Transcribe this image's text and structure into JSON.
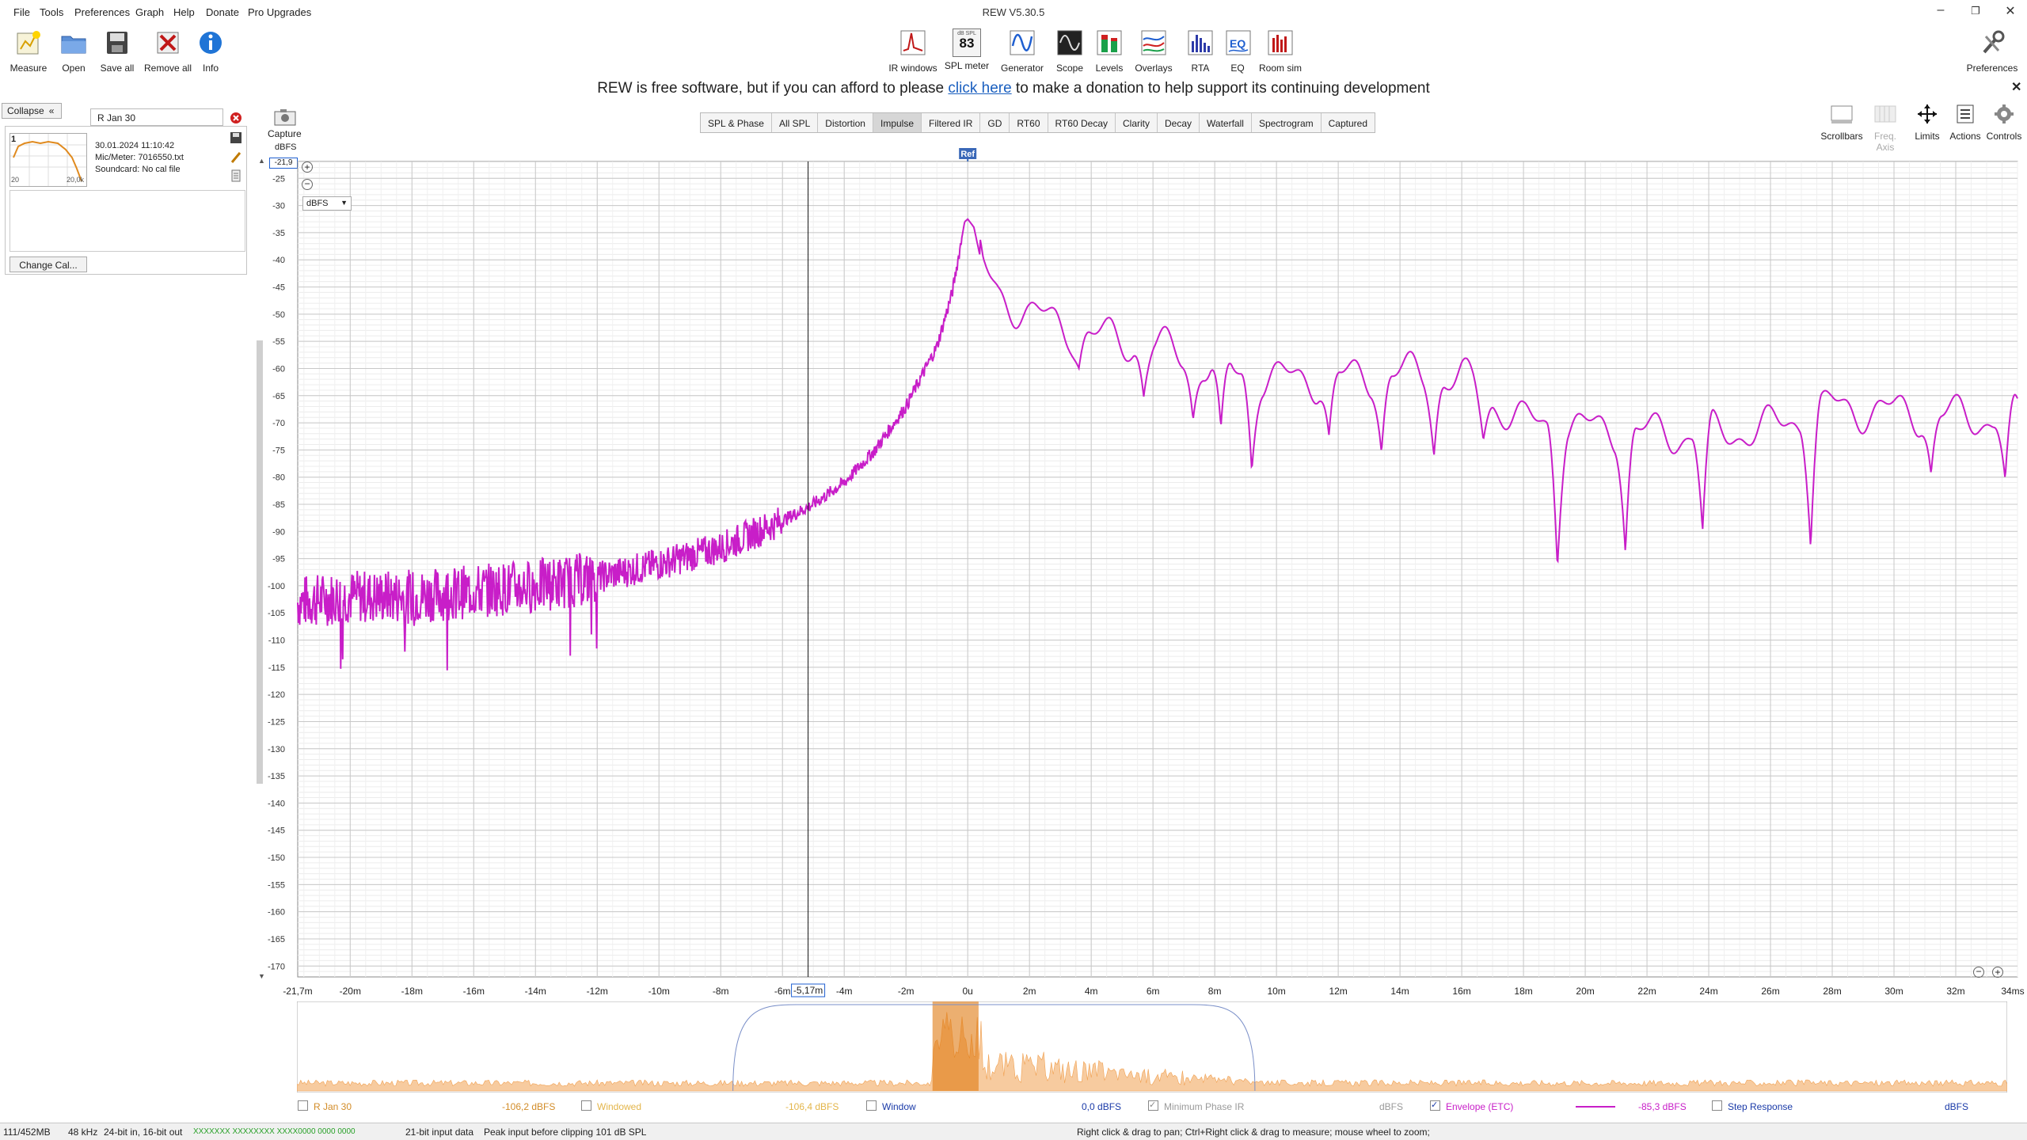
{
  "window": {
    "title": "REW V5.30.5"
  },
  "menu": [
    "File",
    "Tools",
    "Preferences",
    "Graph",
    "Help",
    "Donate",
    "Pro Upgrades"
  ],
  "toolbar_left": [
    {
      "label": "Measure",
      "icon": "measure-icon"
    },
    {
      "label": "Open",
      "icon": "open-folder-icon"
    },
    {
      "label": "Save all",
      "icon": "save-icon"
    },
    {
      "label": "Remove all",
      "icon": "remove-icon"
    },
    {
      "label": "Info",
      "icon": "info-icon"
    }
  ],
  "toolbar_center": [
    {
      "label": "IR windows",
      "icon": "ir-windows-icon"
    },
    {
      "label": "SPL meter",
      "icon": "spl-meter-icon",
      "badge_top": "dB SPL",
      "badge_value": "83"
    },
    {
      "label": "Generator",
      "icon": "generator-icon"
    },
    {
      "label": "Scope",
      "icon": "scope-icon"
    },
    {
      "label": "Levels",
      "icon": "levels-icon"
    },
    {
      "label": "Overlays",
      "icon": "overlays-icon"
    },
    {
      "label": "RTA",
      "icon": "rta-icon"
    },
    {
      "label": "EQ",
      "icon": "eq-icon"
    },
    {
      "label": "Room sim",
      "icon": "room-sim-icon"
    }
  ],
  "toolbar_right": {
    "label": "Preferences",
    "icon": "preferences-icon"
  },
  "banner": {
    "before": "REW is free software, but if you can afford to please ",
    "link": "click here",
    "after": " to make a donation to help support its continuing development"
  },
  "tabs": [
    "SPL & Phase",
    "All SPL",
    "Distortion",
    "Impulse",
    "Filtered IR",
    "GD",
    "RT60",
    "RT60 Decay",
    "Clarity",
    "Decay",
    "Waterfall",
    "Spectrogram",
    "Captured"
  ],
  "active_tab": "Impulse",
  "left_panel": {
    "collapse_label": "Collapse",
    "measurement_name": "R Jan 30",
    "measurement_number": "1",
    "date": "30.01.2024 11:10:42",
    "mic": "Mic/Meter: 7016550.txt",
    "soundcard": "Soundcard: No cal file",
    "thumb_x_min": "20",
    "thumb_x_max": "20,0k",
    "change_cal_label": "Change Cal..."
  },
  "capture": {
    "label": "Capture"
  },
  "graph_controls": [
    {
      "label": "Scrollbars",
      "icon": "scrollbars-icon",
      "disabled": false
    },
    {
      "label": "Freq. Axis",
      "icon": "freq-axis-icon",
      "disabled": true
    },
    {
      "label": "Limits",
      "icon": "limits-icon",
      "disabled": false
    },
    {
      "label": "Actions",
      "icon": "actions-icon",
      "disabled": false
    },
    {
      "label": "Controls",
      "icon": "controls-icon",
      "disabled": false
    }
  ],
  "graph": {
    "y_unit": "dBFS",
    "y_cursor_value": "-21,9",
    "unit_select": "dBFS",
    "ref_label": "Ref",
    "cursor_x_label": "-5,17m",
    "x_first_label": "-21,7m",
    "x_last_label": "34ms"
  },
  "chart_data": {
    "type": "line",
    "title": "",
    "xlabel": "",
    "ylabel": "dBFS",
    "xlim": [
      -21.7,
      34
    ],
    "ylim": [
      -172,
      -21.9
    ],
    "y_ticks": [
      -25,
      -30,
      -35,
      -40,
      -45,
      -50,
      -55,
      -60,
      -65,
      -70,
      -75,
      -80,
      -85,
      -90,
      -95,
      -100,
      -105,
      -110,
      -115,
      -120,
      -125,
      -130,
      -135,
      -140,
      -145,
      -150,
      -155,
      -160,
      -165,
      -170
    ],
    "x_ticks": [
      -20,
      -18,
      -16,
      -14,
      -12,
      -10,
      -8,
      -6,
      -4,
      -2,
      0,
      2,
      4,
      6,
      8,
      10,
      12,
      14,
      16,
      18,
      20,
      22,
      24,
      26,
      28,
      30,
      32
    ],
    "x_tick_labels": [
      "-20m",
      "-18m",
      "-16m",
      "-14m",
      "-12m",
      "-10m",
      "-8m",
      "-6m",
      "-4m",
      "-2m",
      "0u",
      "2m",
      "4m",
      "6m",
      "8m",
      "10m",
      "12m",
      "14m",
      "16m",
      "18m",
      "20m",
      "22m",
      "24m",
      "26m",
      "28m",
      "30m",
      "32m"
    ],
    "cursor_x": -5.17,
    "ref_x": 0,
    "series": [
      {
        "name": "Envelope (ETC)",
        "color": "#c81ec8",
        "envelope_points": [
          {
            "x": -21.7,
            "y": -103
          },
          {
            "x": -20,
            "y": -102
          },
          {
            "x": -18,
            "y": -102
          },
          {
            "x": -16,
            "y": -101
          },
          {
            "x": -14,
            "y": -100
          },
          {
            "x": -12,
            "y": -98.5
          },
          {
            "x": -10,
            "y": -96
          },
          {
            "x": -8,
            "y": -93
          },
          {
            "x": -6,
            "y": -88
          },
          {
            "x": -5,
            "y": -85
          },
          {
            "x": -4,
            "y": -81
          },
          {
            "x": -3,
            "y": -75
          },
          {
            "x": -2,
            "y": -67
          },
          {
            "x": -1,
            "y": -56
          },
          {
            "x": -0.5,
            "y": -46
          },
          {
            "x": -0.1,
            "y": -33
          },
          {
            "x": 0,
            "y": -32.5
          },
          {
            "x": 0.2,
            "y": -34
          },
          {
            "x": 0.5,
            "y": -42
          },
          {
            "x": 1,
            "y": -46
          },
          {
            "x": 2,
            "y": -50
          },
          {
            "x": 3,
            "y": -52
          },
          {
            "x": 4,
            "y": -54
          },
          {
            "x": 5,
            "y": -55
          },
          {
            "x": 6,
            "y": -56
          },
          {
            "x": 8,
            "y": -60
          },
          {
            "x": 10,
            "y": -62
          },
          {
            "x": 12,
            "y": -62
          },
          {
            "x": 14,
            "y": -61
          },
          {
            "x": 16,
            "y": -62
          },
          {
            "x": 18,
            "y": -70
          },
          {
            "x": 20,
            "y": -71
          },
          {
            "x": 22,
            "y": -72
          },
          {
            "x": 24,
            "y": -72
          },
          {
            "x": 26,
            "y": -71
          },
          {
            "x": 28,
            "y": -67
          },
          {
            "x": 30,
            "y": -68
          },
          {
            "x": 32,
            "y": -69
          },
          {
            "x": 34,
            "y": -69
          }
        ],
        "notches": [
          {
            "x": 3.6,
            "y": -58
          },
          {
            "x": 5.7,
            "y": -64
          },
          {
            "x": 7.3,
            "y": -68
          },
          {
            "x": 8.2,
            "y": -75
          },
          {
            "x": 9.2,
            "y": -77
          },
          {
            "x": 11.7,
            "y": -73
          },
          {
            "x": 13.4,
            "y": -74
          },
          {
            "x": 15.1,
            "y": -74
          },
          {
            "x": 16.7,
            "y": -72
          },
          {
            "x": 19.1,
            "y": -93
          },
          {
            "x": 21.3,
            "y": -92
          },
          {
            "x": 23.8,
            "y": -91
          },
          {
            "x": 27.3,
            "y": -90
          },
          {
            "x": 31.2,
            "y": -79
          },
          {
            "x": 33.6,
            "y": -82
          }
        ]
      }
    ]
  },
  "overview": {
    "color": "#f0a050",
    "window_start": -7.5,
    "window_end": 9.5
  },
  "legend": {
    "rows": [
      {
        "label": "R Jan 30",
        "value": "-106,2 dBFS",
        "checked": false,
        "color": "#d28c28"
      },
      {
        "label": "Windowed",
        "value": "-106,4 dBFS",
        "checked": false,
        "color": "#e3b54a"
      },
      {
        "label": "Window",
        "value": "0,0 dBFS",
        "checked": false,
        "color": "#1a3aa8"
      },
      {
        "label": "Minimum Phase IR",
        "value": "dBFS",
        "checked": true,
        "color": "#9a9a9a"
      },
      {
        "label": "Envelope (ETC)",
        "value": "-85,3 dBFS",
        "checked": true,
        "color": "#c81ec8"
      },
      {
        "label": "Step Response",
        "value": "dBFS",
        "checked": false,
        "color": "#1a3aa8"
      }
    ]
  },
  "status": {
    "memory": "111/452MB",
    "rate": "48 kHz",
    "bits": "24-bit in, 16-bit out",
    "bit_pattern": "XXXXXXX XXXXXXXX XXXX0000 0000 0000",
    "input_data": "21-bit input data",
    "peak": "Peak input before clipping 101 dB SPL",
    "hint": "Right click & drag to pan; Ctrl+Right click & drag to measure; mouse wheel to zoom;"
  }
}
